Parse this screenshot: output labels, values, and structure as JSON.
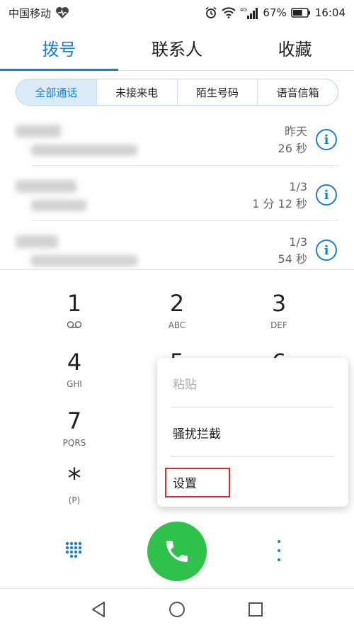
{
  "status_bar": {
    "carrier": "中国移动",
    "network": "4G",
    "battery": "67%",
    "time": "16:04",
    "battery_level": 0.67
  },
  "tabs": [
    {
      "label": "拨号",
      "active": true
    },
    {
      "label": "联系人",
      "active": false
    },
    {
      "label": "收藏",
      "active": false
    }
  ],
  "filters": [
    {
      "label": "全部通话",
      "active": true
    },
    {
      "label": "未接来电",
      "active": false
    },
    {
      "label": "陌生号码",
      "active": false
    },
    {
      "label": "语音信箱",
      "active": false
    }
  ],
  "calls": [
    {
      "date": "昨天",
      "duration": "26 秒"
    },
    {
      "date": "1/3",
      "duration": "1 分 12 秒"
    },
    {
      "date": "1/3",
      "duration": "54 秒"
    }
  ],
  "dialpad": {
    "keys": [
      {
        "num": "1",
        "sub": ""
      },
      {
        "num": "2",
        "sub": "ABC"
      },
      {
        "num": "3",
        "sub": "DEF"
      },
      {
        "num": "4",
        "sub": "GHI"
      },
      {
        "num": "5",
        "sub": ""
      },
      {
        "num": "6",
        "sub": ""
      },
      {
        "num": "7",
        "sub": "PQRS"
      },
      {
        "num": "*",
        "sub": "(P)"
      }
    ]
  },
  "menu": {
    "items": [
      {
        "label": "粘贴",
        "enabled": false
      },
      {
        "label": "骚扰拦截",
        "enabled": true
      },
      {
        "label": "设置",
        "enabled": true
      }
    ]
  },
  "colors": {
    "accent": "#1a7fd4",
    "call_button": "#2fc24a",
    "highlight": "#d62d2d"
  }
}
